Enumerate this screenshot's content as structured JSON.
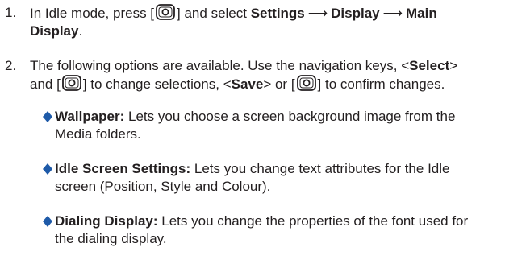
{
  "steps": [
    {
      "number": "1.",
      "text_a": "In Idle mode, press [",
      "text_b": "] and select ",
      "menu_1": "Settings",
      "arrow_1": "⟶",
      "menu_2": "Display",
      "arrow_2": "⟶",
      "menu_3": "Main",
      "menu_3b": "Display",
      "end": "."
    },
    {
      "number": "2.",
      "text_a": "The following options are available. Use the navigation keys, <",
      "select": "Select",
      "text_b": ">",
      "text_c": "and [",
      "text_d": "] to change selections, <",
      "save": "Save",
      "text_e": "> or [",
      "text_f": "] to confirm changes."
    }
  ],
  "options": [
    {
      "name": "Wallpaper:",
      "line1": " Lets you choose a screen background image from the",
      "line2": "Media folders."
    },
    {
      "name": "Idle Screen Settings:",
      "line1": " Lets you change text attributes for the Idle",
      "line2": "screen (Position, Style and Colour)."
    },
    {
      "name": "Dialing Display:",
      "line1": " Lets you change the properties of the font used for",
      "line2": "the dialing display."
    }
  ],
  "icons": {
    "key": "ok-key-icon",
    "bullet": "diamond-bullet-icon"
  },
  "colors": {
    "text": "#231f20",
    "bullet": "#1e5aa8"
  }
}
